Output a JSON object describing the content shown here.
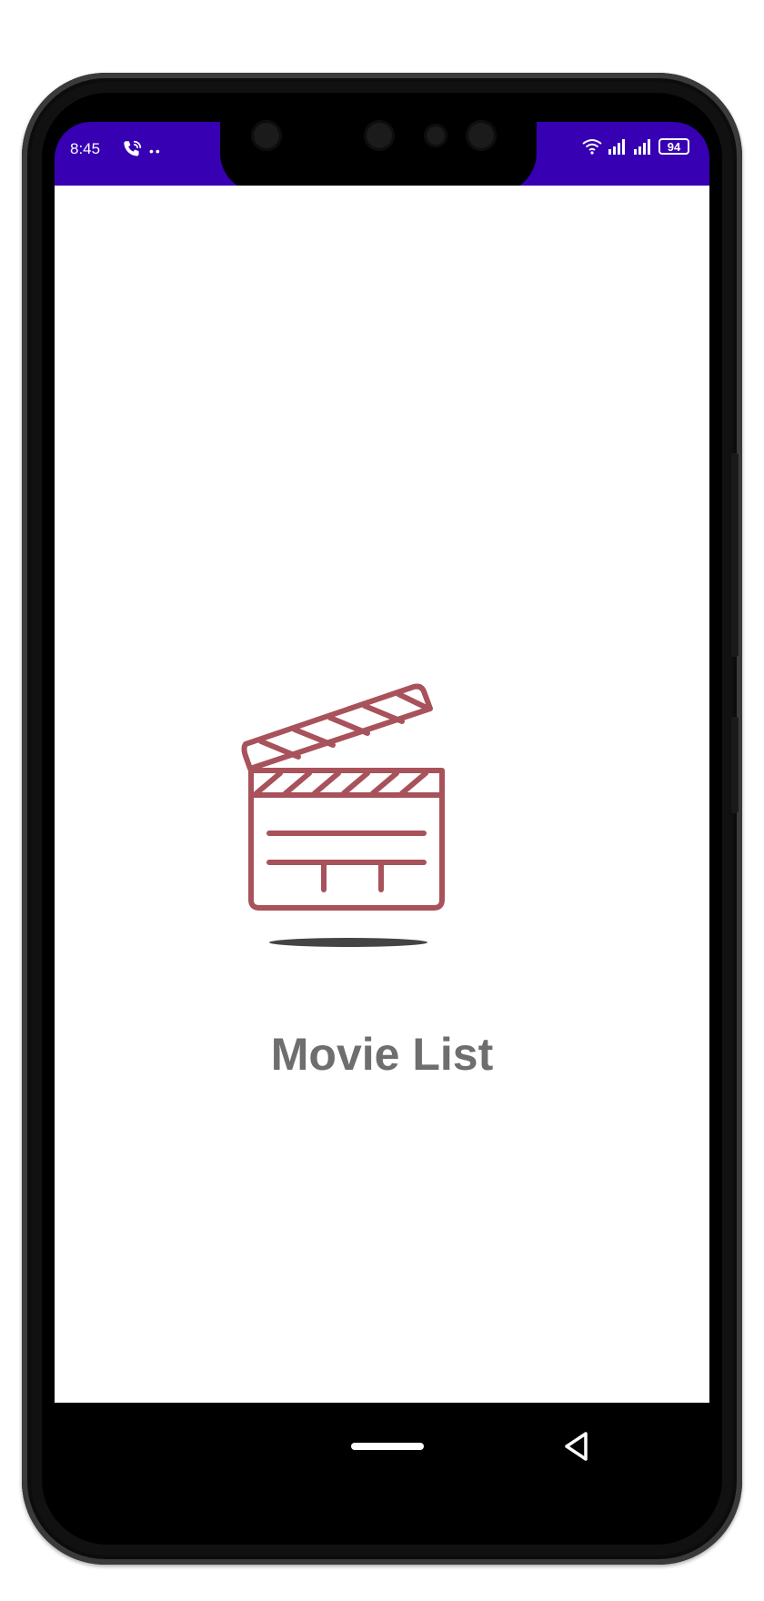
{
  "status_bar": {
    "time": "8:45",
    "indicator_dots": "••",
    "battery_level": "94",
    "background_color": "#3700b3"
  },
  "app": {
    "title": "Movie List",
    "logo_icon": "clapperboard-icon",
    "logo_color": "#a8525b",
    "title_color": "#6e6e6e"
  },
  "navigation_bar": {
    "home_icon": "home-pill-icon",
    "back_icon": "back-triangle-icon"
  }
}
